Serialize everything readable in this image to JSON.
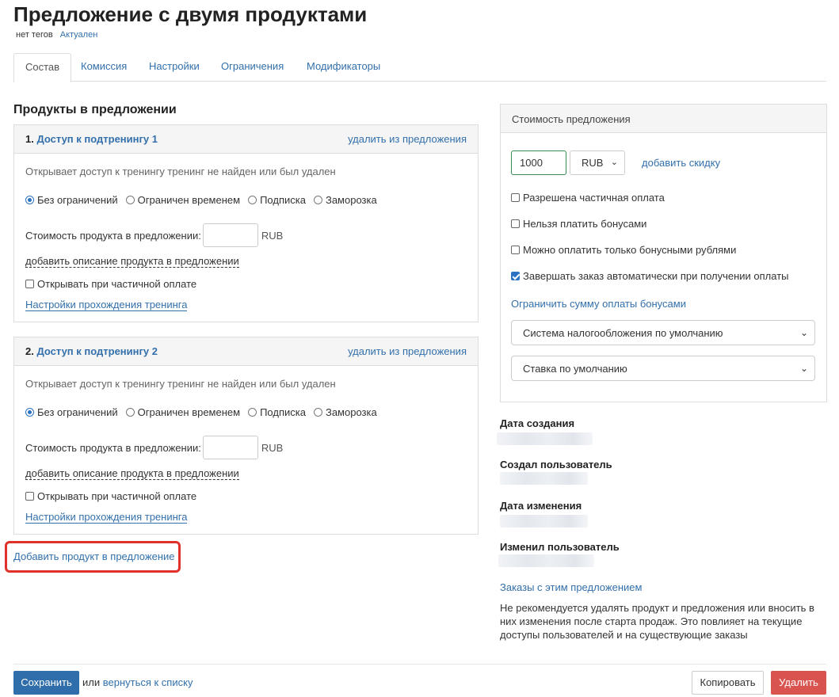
{
  "page": {
    "title": "Предложение с двумя продуктами",
    "tags_text": "нет тегов",
    "status": "Актуален"
  },
  "tabs": [
    "Состав",
    "Комиссия",
    "Настройки",
    "Ограничения",
    "Модификаторы"
  ],
  "products_section": {
    "title": "Продукты в предложении",
    "products": [
      {
        "number": "1.",
        "name": "Доступ к подтренингу 1",
        "remove_label": "удалить из предложения",
        "description": "Открывает доступ к тренингу тренинг не найден или был удален",
        "radio_options": [
          "Без ограничений",
          "Ограничен временем",
          "Подписка",
          "Заморозка"
        ],
        "selected_radio": "Без ограничений",
        "price_label": "Стоимость продукта в предложении:",
        "price_value": "",
        "price_currency": "RUB",
        "add_description_label": "добавить описание продукта в предложении",
        "partial_payment_label": "Открывать при частичной оплате",
        "training_settings_label": "Настройки прохождения тренинга"
      },
      {
        "number": "2.",
        "name": "Доступ к подтренингу 2",
        "remove_label": "удалить из предложения",
        "description": "Открывает доступ к тренингу тренинг не найден или был удален",
        "radio_options": [
          "Без ограничений",
          "Ограничен временем",
          "Подписка",
          "Заморозка"
        ],
        "selected_radio": "Без ограничений",
        "price_label": "Стоимость продукта в предложении:",
        "price_value": "",
        "price_currency": "RUB",
        "add_description_label": "добавить описание продукта в предложении",
        "partial_payment_label": "Открывать при частичной оплате",
        "training_settings_label": "Настройки прохождения тренинга"
      }
    ],
    "add_product_label": "Добавить продукт в предложение"
  },
  "cost": {
    "title": "Стоимость предложения",
    "amount": "1000",
    "currency": "RUB",
    "add_discount_label": "добавить скидку",
    "options": [
      {
        "label": "Разрешена частичная оплата",
        "checked": false
      },
      {
        "label": "Нельзя платить бонусами",
        "checked": false
      },
      {
        "label": "Можно оплатить только бонусными рублями",
        "checked": false
      },
      {
        "label": "Завершать заказ автоматически при получении оплаты",
        "checked": true
      }
    ],
    "limit_bonus_label": "Ограничить сумму оплаты бонусами",
    "tax_system": "Система налогообложения по умолчанию",
    "tax_rate": "Ставка по умолчанию"
  },
  "meta": {
    "created_date_label": "Дата создания",
    "created_by_label": "Создал пользователь",
    "modified_date_label": "Дата изменения",
    "modified_by_label": "Изменил пользователь",
    "orders_link": "Заказы с этим предложением",
    "warning": "Не рекомендуется удалять продукт и предложения или вносить в них изменения после старта продаж. Это повлияет на текущие доступы пользователей и на существующие заказы"
  },
  "footer": {
    "save_label": "Сохранить",
    "or_text": "или",
    "back_label": "вернуться к списку",
    "copy_label": "Копировать",
    "delete_label": "Удалить"
  },
  "colors": {
    "link": "#3370ab",
    "primary_button": "#2f6eaa",
    "danger_button": "#d9534f",
    "highlight_outline": "#e0312a"
  }
}
